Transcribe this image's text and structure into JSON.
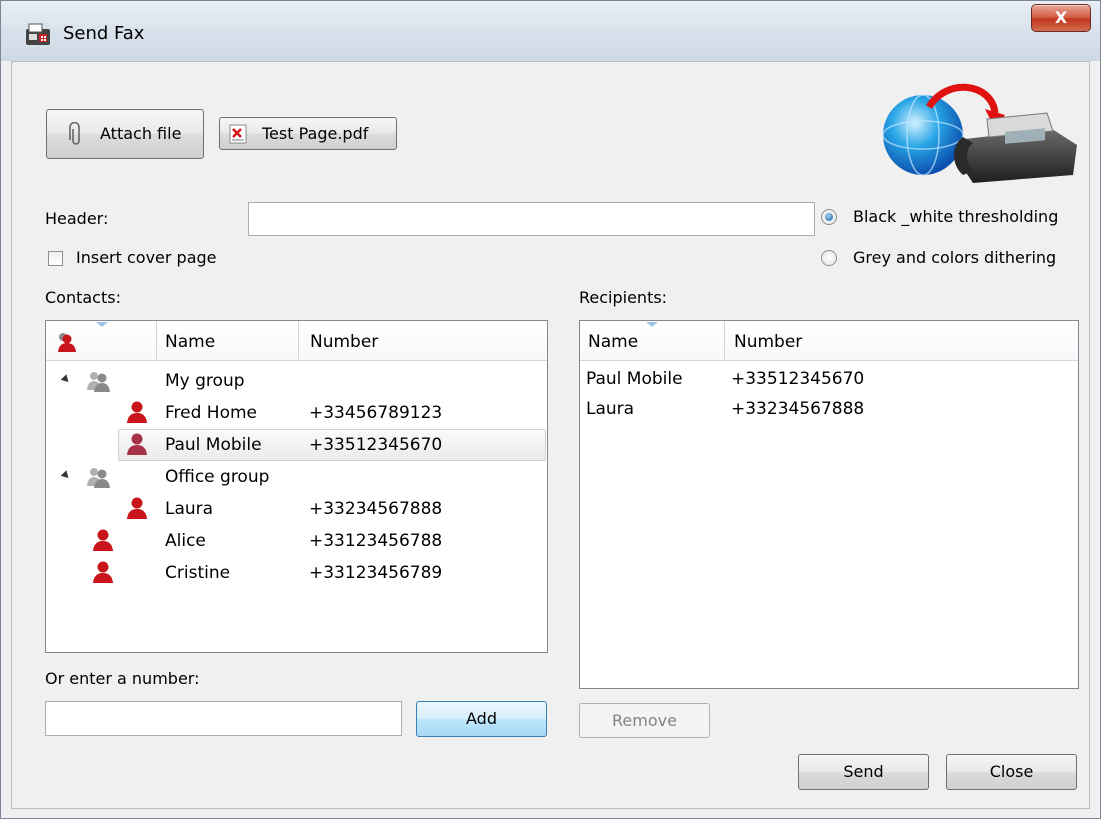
{
  "window": {
    "title": "Send Fax",
    "close_glyph": "X"
  },
  "icons": {
    "app": "fax-app-icon",
    "paperclip": "paperclip-icon",
    "pdf": "pdf-icon",
    "globe_fax": "globe-fax-logo",
    "user": "user-icon",
    "group": "group-icon"
  },
  "toolbar": {
    "attach_label": "Attach file",
    "attachment_name": "Test Page.pdf"
  },
  "header": {
    "label": "Header:",
    "value": ""
  },
  "options": {
    "cover_page_label": "Insert cover page",
    "cover_page_checked": false,
    "bw_label": "Black _white thresholding",
    "grey_label": "Grey and colors dithering",
    "selected": "bw"
  },
  "contacts": {
    "label": "Contacts:",
    "columns": [
      "Name",
      "Number"
    ],
    "rows": [
      {
        "type": "group",
        "name": "My group",
        "number": "",
        "level": 0
      },
      {
        "type": "contact",
        "name": "Fred Home",
        "number": "+33456789123",
        "level": 1
      },
      {
        "type": "contact",
        "name": "Paul Mobile",
        "number": "+33512345670",
        "level": 1,
        "selected": true
      },
      {
        "type": "group",
        "name": "Office group",
        "number": "",
        "level": 0
      },
      {
        "type": "contact",
        "name": "Laura",
        "number": "+33234567888",
        "level": 1
      },
      {
        "type": "contact",
        "name": "Alice",
        "number": "+33123456788",
        "level": 0
      },
      {
        "type": "contact",
        "name": "Cristine",
        "number": "+33123456789",
        "level": 0
      }
    ]
  },
  "recipients": {
    "label": "Recipients:",
    "columns": [
      "Name",
      "Number"
    ],
    "rows": [
      {
        "name": "Paul Mobile",
        "number": "+33512345670"
      },
      {
        "name": "Laura",
        "number": "+33234567888"
      }
    ]
  },
  "manual": {
    "label": "Or enter a number:",
    "value": "",
    "add_label": "Add"
  },
  "actions": {
    "remove_label": "Remove",
    "send_label": "Send",
    "close_label": "Close"
  },
  "colors": {
    "contact_red": "#c8151b",
    "contact_selected": "#a8324a",
    "group_grey": "#8a8a8a"
  }
}
